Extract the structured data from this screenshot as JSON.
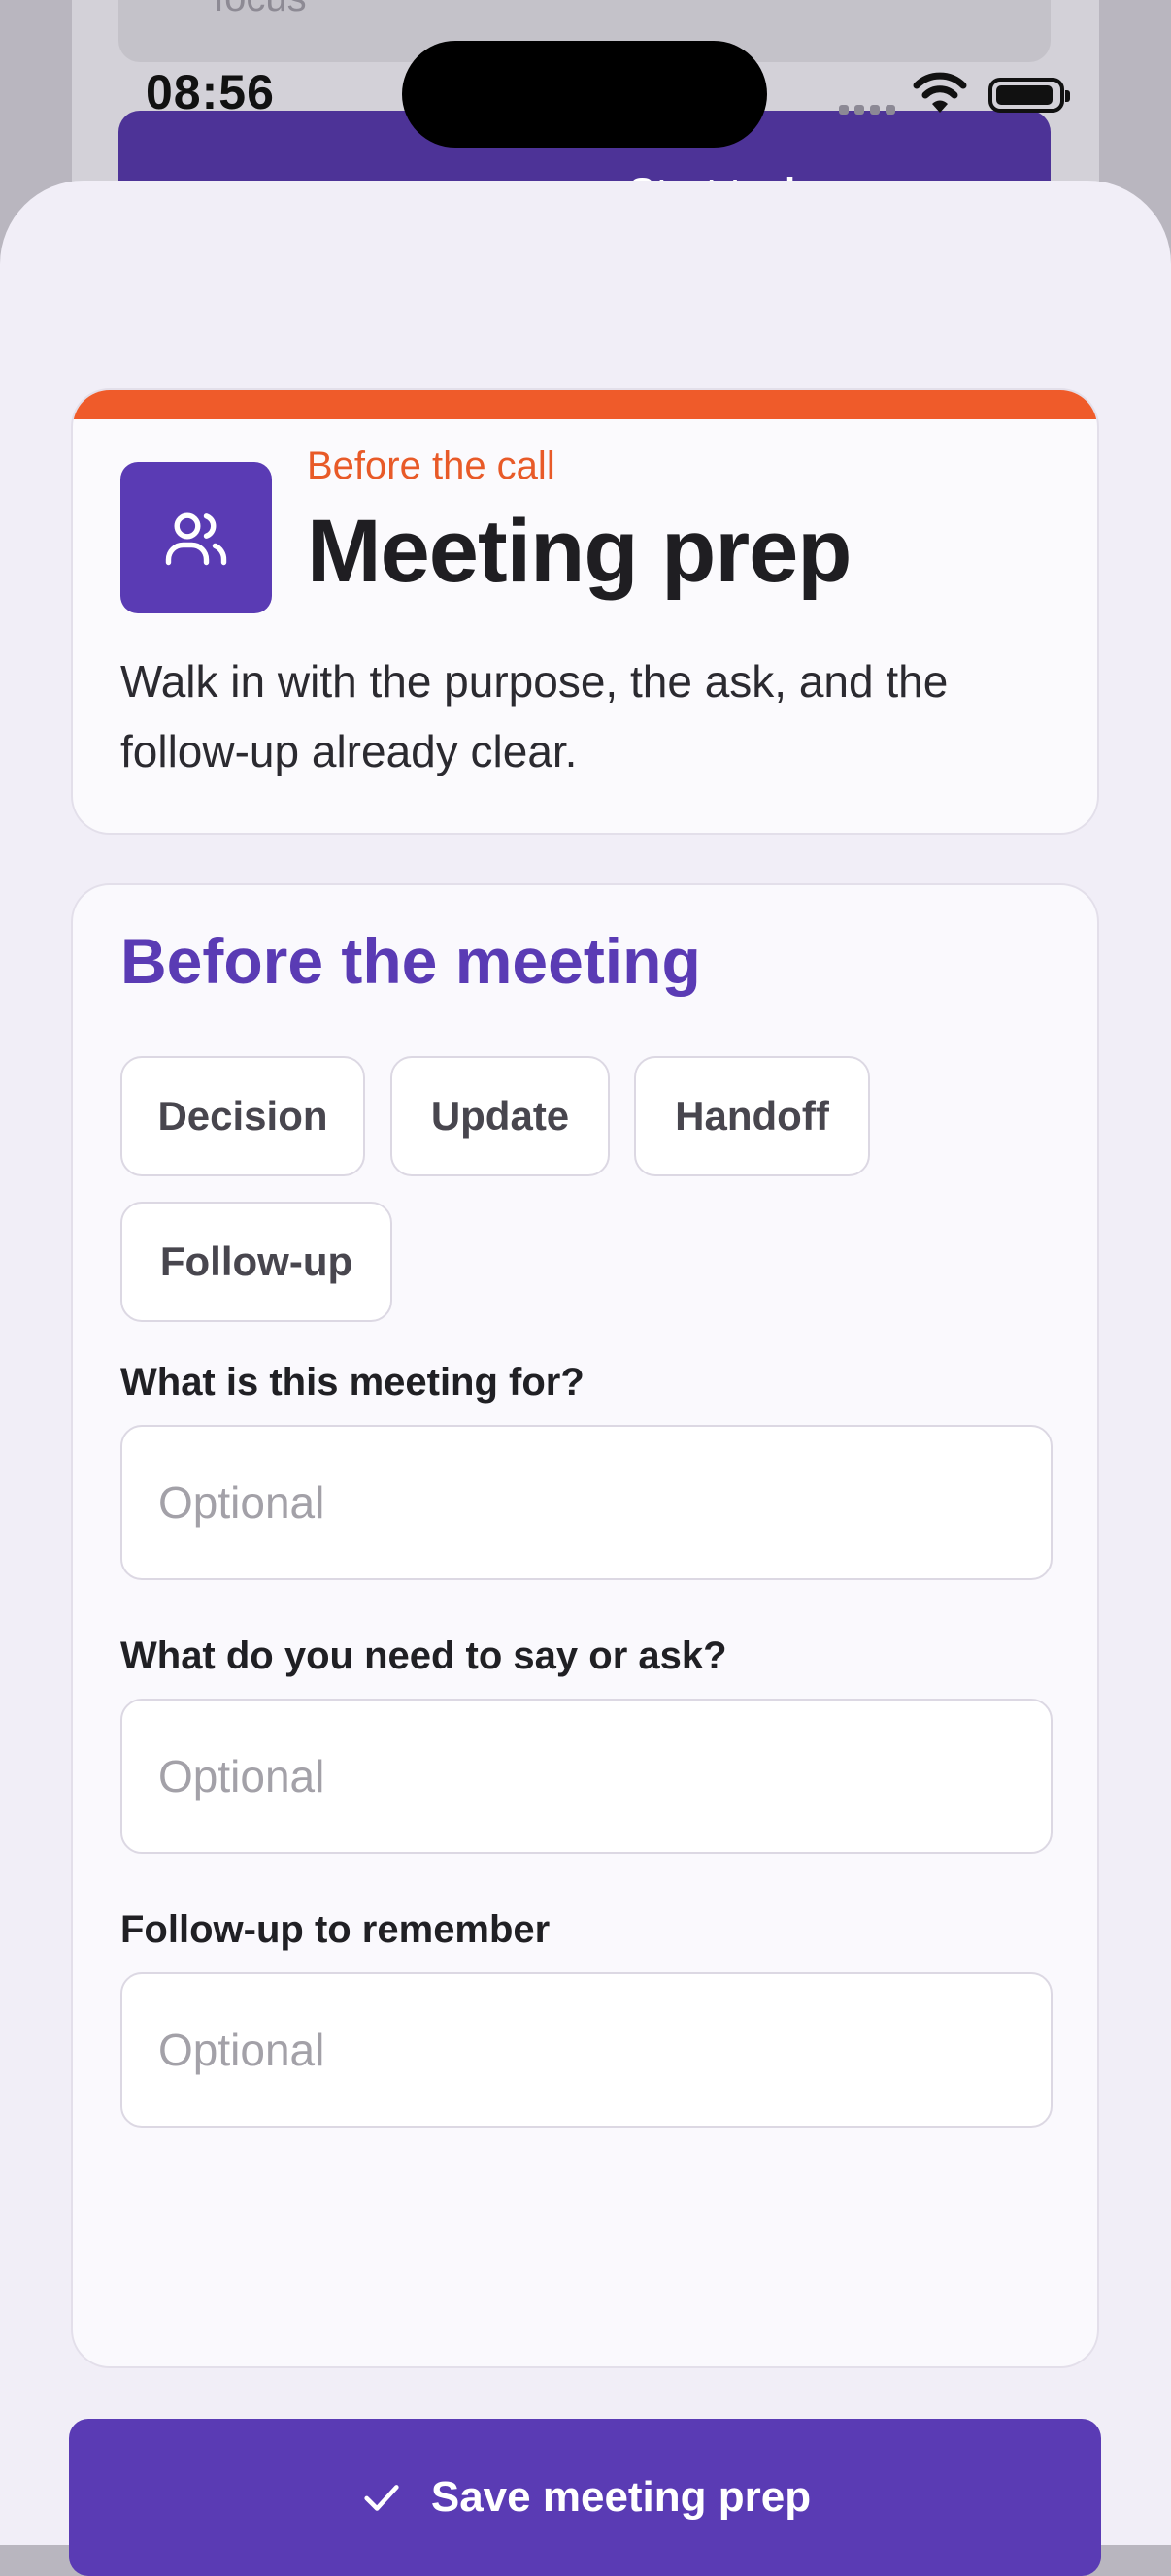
{
  "background": {
    "card_text": "focus",
    "button_label": "Start task",
    "button_icon": "chevron-right-icon"
  },
  "status_bar": {
    "time": "08:56",
    "icons": [
      "signal-icon",
      "wifi-icon",
      "battery-icon"
    ]
  },
  "header": {
    "icon": "people-icon",
    "eyebrow": "Before the call",
    "title": "Meeting prep",
    "description": "Walk in with the purpose, the ask, and the follow-up already clear."
  },
  "form": {
    "section_title": "Before the meeting",
    "chips": [
      "Decision",
      "Update",
      "Handoff",
      "Follow-up"
    ],
    "fields": [
      {
        "label": "What is this meeting for?",
        "placeholder": "Optional",
        "value": ""
      },
      {
        "label": "What do you need to say or ask?",
        "placeholder": "Optional",
        "value": ""
      },
      {
        "label": "Follow-up to remember",
        "placeholder": "Optional",
        "value": ""
      }
    ]
  },
  "save_button": {
    "icon": "checkmark-icon",
    "label": "Save meeting prep"
  },
  "colors": {
    "accent": "#5a3bb4",
    "eyebrow": "#e85a28",
    "strip": "#ef5b2a",
    "sheet_bg": "#f1eef7"
  }
}
